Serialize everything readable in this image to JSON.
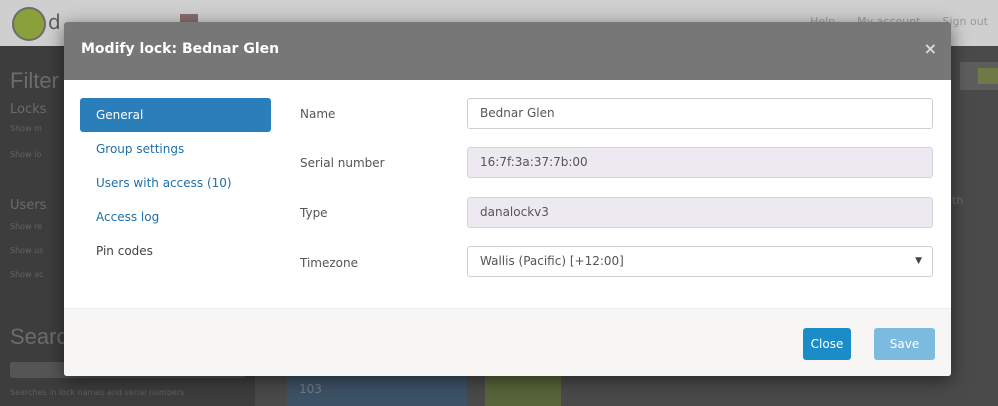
{
  "background": {
    "topnav": [
      "Help",
      "My account",
      "Sign out"
    ],
    "sidebar": {
      "filter_heading": "Filter",
      "locks_heading": "Locks",
      "locks_rows": [
        "Show m",
        "Show lo"
      ],
      "users_heading": "Users",
      "users_rows": [
        "Show re",
        "Show us",
        "Show ac"
      ],
      "search_heading": "Search",
      "search_hint": "Searches in lock names and serial numbers"
    },
    "card_label": "103",
    "column_fragment": "th"
  },
  "modal": {
    "title": "Modify lock: Bednar Glen",
    "close_symbol": "×",
    "tabs": [
      {
        "label": "General",
        "active": true
      },
      {
        "label": "Group settings",
        "active": false
      },
      {
        "label": "Users with access (10)",
        "active": false
      },
      {
        "label": "Access log",
        "active": false
      },
      {
        "label": "Pin codes",
        "active": false
      }
    ],
    "form": {
      "name_label": "Name",
      "name_value": "Bednar Glen",
      "serial_label": "Serial number",
      "serial_value": "16:7f:3a:37:7b:00",
      "type_label": "Type",
      "type_value": "danalockv3",
      "timezone_label": "Timezone",
      "timezone_value": "Wallis (Pacific) [+12:00]"
    },
    "footer": {
      "close_label": "Close",
      "save_label": "Save"
    }
  },
  "colors": {
    "primary": "#2a7fba",
    "close_button": "#1a8dc9",
    "save_button_disabled": "#7cbbe0",
    "header": "#777777"
  }
}
